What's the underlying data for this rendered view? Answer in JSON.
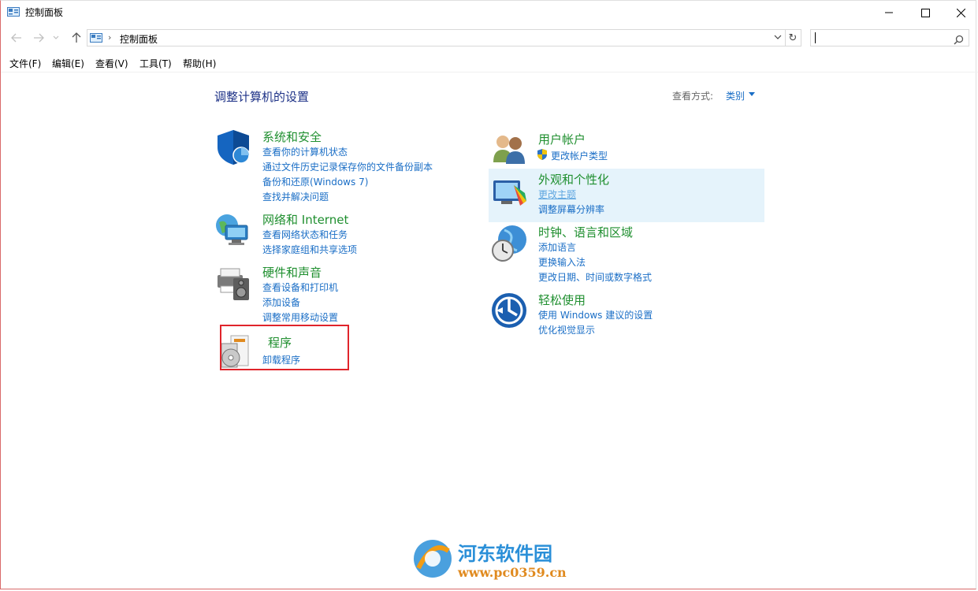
{
  "window": {
    "title": "控制面板"
  },
  "address": {
    "crumb": "控制面板",
    "search_value": ""
  },
  "menu": [
    "文件(F)",
    "编辑(E)",
    "查看(V)",
    "工具(T)",
    "帮助(H)"
  ],
  "main": {
    "heading": "调整计算机的设置",
    "view_by_label": "查看方式:",
    "view_by_value": "类别"
  },
  "categories": {
    "system_security": {
      "title": "系统和安全",
      "links": [
        "查看你的计算机状态",
        "通过文件历史记录保存你的文件备份副本",
        "备份和还原(Windows 7)",
        "查找并解决问题"
      ]
    },
    "network": {
      "title": "网络和 Internet",
      "links": [
        "查看网络状态和任务",
        "选择家庭组和共享选项"
      ]
    },
    "hardware": {
      "title": "硬件和声音",
      "links": [
        "查看设备和打印机",
        "添加设备",
        "调整常用移动设置"
      ]
    },
    "programs": {
      "title": "程序",
      "links": [
        "卸载程序"
      ]
    },
    "user_accounts": {
      "title": "用户帐户",
      "links": [
        "更改帐户类型"
      ]
    },
    "appearance": {
      "title": "外观和个性化",
      "links": [
        "更改主题",
        "调整屏幕分辨率"
      ]
    },
    "clock_region": {
      "title": "时钟、语言和区域",
      "links": [
        "添加语言",
        "更换输入法",
        "更改日期、时间或数字格式"
      ]
    },
    "ease_of_access": {
      "title": "轻松使用",
      "links": [
        "使用 Windows 建议的设置",
        "优化视觉显示"
      ]
    }
  },
  "watermark": {
    "name": "河东软件园",
    "url": "www.pc0359.cn"
  },
  "colors": {
    "category_title": "#1f8f2f",
    "link": "#1a6ec6",
    "heading": "#1e3287",
    "highlight": "#e5f3fb",
    "annotation_box": "#e0242b"
  }
}
